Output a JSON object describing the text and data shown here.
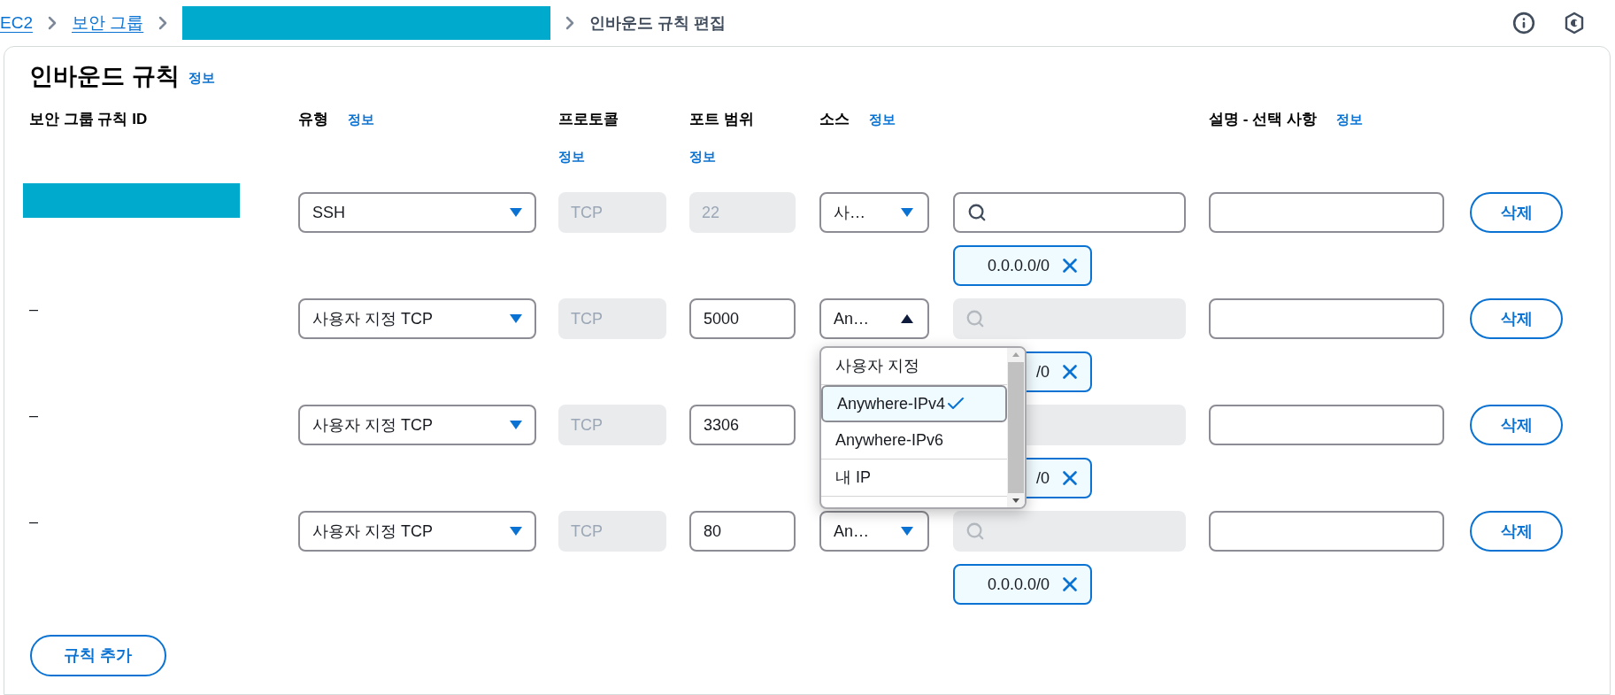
{
  "breadcrumbs": [
    {
      "kind": "link",
      "label": "EC2"
    },
    {
      "kind": "link",
      "label": "보안 그룹"
    },
    {
      "kind": "redacted"
    },
    {
      "kind": "current",
      "label": "인바운드 규칙 편집"
    }
  ],
  "panel": {
    "title": "인바운드 규칙",
    "info": "정보"
  },
  "columns": [
    {
      "label": "보안 그룹 규칙 ID"
    },
    {
      "label": "유형",
      "info": "정보",
      "kind": "inline"
    },
    {
      "label": "프로토콜",
      "info": "정보",
      "kind": "below"
    },
    {
      "label": "포트 범위",
      "info": "정보",
      "kind": "below"
    },
    {
      "label": "소스",
      "info": "정보",
      "kind": "inline"
    },
    {
      "label": "설명 - 선택 사항",
      "info": "정보",
      "kind": "inline"
    }
  ],
  "rules": [
    {
      "rule_id": {
        "kind": "redacted"
      },
      "type": "SSH",
      "protocol": "TCP",
      "port": "22",
      "port_disabled": true,
      "source": {
        "value": "사…",
        "expanded": false
      },
      "search_disabled": false,
      "search_icon": true,
      "chip": "0.0.0.0/0",
      "delete": "삭제"
    },
    {
      "rule_id": {
        "kind": "text",
        "text": "–"
      },
      "type": "사용자 지정 TCP",
      "protocol": "TCP",
      "port": "5000",
      "port_disabled": false,
      "source": {
        "value": "An…",
        "expanded": true,
        "options": [
          {
            "label": "사용자 지정",
            "selected": false
          },
          {
            "label": "Anywhere-IPv4",
            "selected": true
          },
          {
            "label": "Anywhere-IPv6",
            "selected": false
          },
          {
            "label": "내 IP",
            "selected": false
          }
        ]
      },
      "search_disabled": true,
      "search_icon": true,
      "chip": "/0",
      "delete": "삭제"
    },
    {
      "rule_id": {
        "kind": "text",
        "text": "–"
      },
      "type": "사용자 지정 TCP",
      "protocol": "TCP",
      "port": "3306",
      "port_disabled": false,
      "search_disabled": true,
      "search_icon": false,
      "chip": "/0",
      "delete": "삭제"
    },
    {
      "rule_id": {
        "kind": "text",
        "text": "–"
      },
      "type": "사용자 지정 TCP",
      "protocol": "TCP",
      "port": "80",
      "port_disabled": false,
      "source": {
        "value": "An…",
        "expanded": false
      },
      "search_disabled": true,
      "search_icon": true,
      "chip": "0.0.0.0/0",
      "delete": "삭제"
    }
  ],
  "add_button": "규칙 추가"
}
